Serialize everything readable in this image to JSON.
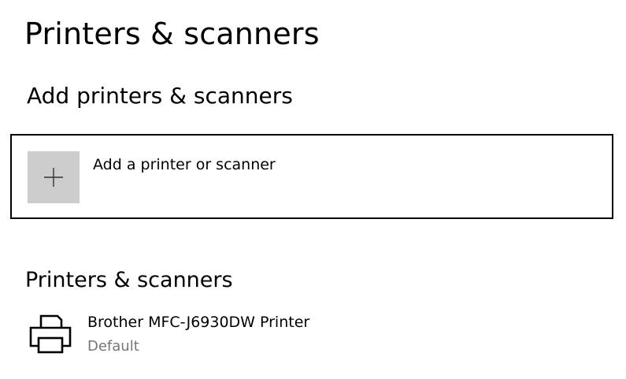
{
  "page": {
    "title": "Printers & scanners"
  },
  "add_section": {
    "heading": "Add printers & scanners",
    "button_label": "Add a printer or scanner",
    "button_icon": "plus-icon"
  },
  "devices_section": {
    "heading": "Printers & scanners",
    "devices": [
      {
        "name": "Brother MFC-J6930DW Printer",
        "status": "Default",
        "icon": "printer-icon"
      }
    ]
  },
  "colors": {
    "icon_tile": "#cccccc",
    "secondary_text": "#767676",
    "focus_border": "#000000"
  }
}
